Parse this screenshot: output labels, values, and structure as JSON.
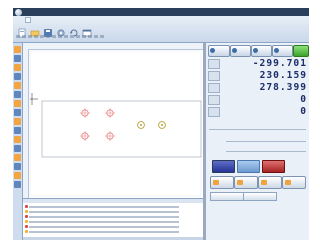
{
  "window": {
    "title": ""
  },
  "ribbon": {
    "tabs": [],
    "groups": []
  },
  "dro": {
    "x": "-299.701",
    "y": "230.159",
    "z": "278.399",
    "a": "0",
    "b": "0"
  },
  "colors": {
    "accent": "#2a3f5c",
    "dro_text": "#1b2d6b",
    "hole_red": "#e45a5a",
    "hole_olive": "#b8a23a",
    "go_green": "#3da32b"
  },
  "list": {
    "rows": []
  }
}
